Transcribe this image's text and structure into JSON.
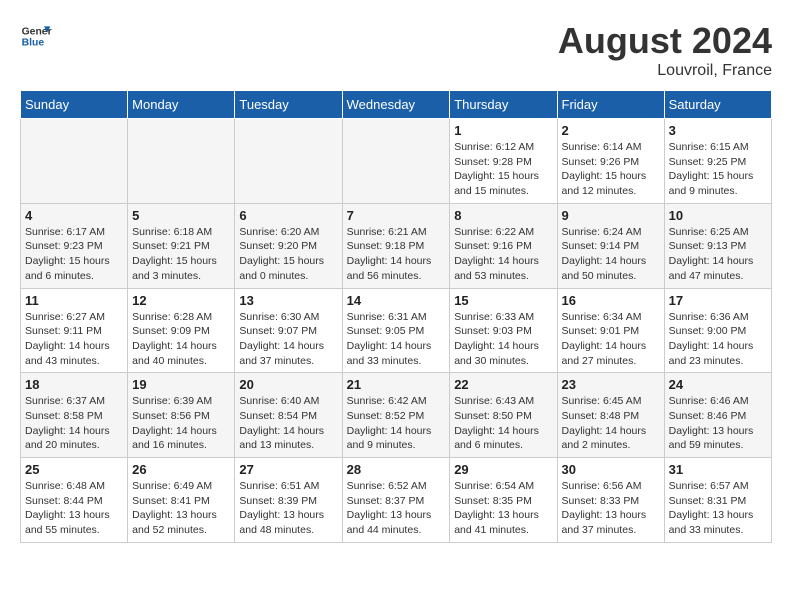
{
  "header": {
    "logo_line1": "General",
    "logo_line2": "Blue",
    "month_year": "August 2024",
    "location": "Louvroil, France"
  },
  "days_of_week": [
    "Sunday",
    "Monday",
    "Tuesday",
    "Wednesday",
    "Thursday",
    "Friday",
    "Saturday"
  ],
  "weeks": [
    [
      {
        "day": "",
        "info": ""
      },
      {
        "day": "",
        "info": ""
      },
      {
        "day": "",
        "info": ""
      },
      {
        "day": "",
        "info": ""
      },
      {
        "day": "1",
        "info": "Sunrise: 6:12 AM\nSunset: 9:28 PM\nDaylight: 15 hours and 15 minutes."
      },
      {
        "day": "2",
        "info": "Sunrise: 6:14 AM\nSunset: 9:26 PM\nDaylight: 15 hours and 12 minutes."
      },
      {
        "day": "3",
        "info": "Sunrise: 6:15 AM\nSunset: 9:25 PM\nDaylight: 15 hours and 9 minutes."
      }
    ],
    [
      {
        "day": "4",
        "info": "Sunrise: 6:17 AM\nSunset: 9:23 PM\nDaylight: 15 hours and 6 minutes."
      },
      {
        "day": "5",
        "info": "Sunrise: 6:18 AM\nSunset: 9:21 PM\nDaylight: 15 hours and 3 minutes."
      },
      {
        "day": "6",
        "info": "Sunrise: 6:20 AM\nSunset: 9:20 PM\nDaylight: 15 hours and 0 minutes."
      },
      {
        "day": "7",
        "info": "Sunrise: 6:21 AM\nSunset: 9:18 PM\nDaylight: 14 hours and 56 minutes."
      },
      {
        "day": "8",
        "info": "Sunrise: 6:22 AM\nSunset: 9:16 PM\nDaylight: 14 hours and 53 minutes."
      },
      {
        "day": "9",
        "info": "Sunrise: 6:24 AM\nSunset: 9:14 PM\nDaylight: 14 hours and 50 minutes."
      },
      {
        "day": "10",
        "info": "Sunrise: 6:25 AM\nSunset: 9:13 PM\nDaylight: 14 hours and 47 minutes."
      }
    ],
    [
      {
        "day": "11",
        "info": "Sunrise: 6:27 AM\nSunset: 9:11 PM\nDaylight: 14 hours and 43 minutes."
      },
      {
        "day": "12",
        "info": "Sunrise: 6:28 AM\nSunset: 9:09 PM\nDaylight: 14 hours and 40 minutes."
      },
      {
        "day": "13",
        "info": "Sunrise: 6:30 AM\nSunset: 9:07 PM\nDaylight: 14 hours and 37 minutes."
      },
      {
        "day": "14",
        "info": "Sunrise: 6:31 AM\nSunset: 9:05 PM\nDaylight: 14 hours and 33 minutes."
      },
      {
        "day": "15",
        "info": "Sunrise: 6:33 AM\nSunset: 9:03 PM\nDaylight: 14 hours and 30 minutes."
      },
      {
        "day": "16",
        "info": "Sunrise: 6:34 AM\nSunset: 9:01 PM\nDaylight: 14 hours and 27 minutes."
      },
      {
        "day": "17",
        "info": "Sunrise: 6:36 AM\nSunset: 9:00 PM\nDaylight: 14 hours and 23 minutes."
      }
    ],
    [
      {
        "day": "18",
        "info": "Sunrise: 6:37 AM\nSunset: 8:58 PM\nDaylight: 14 hours and 20 minutes."
      },
      {
        "day": "19",
        "info": "Sunrise: 6:39 AM\nSunset: 8:56 PM\nDaylight: 14 hours and 16 minutes."
      },
      {
        "day": "20",
        "info": "Sunrise: 6:40 AM\nSunset: 8:54 PM\nDaylight: 14 hours and 13 minutes."
      },
      {
        "day": "21",
        "info": "Sunrise: 6:42 AM\nSunset: 8:52 PM\nDaylight: 14 hours and 9 minutes."
      },
      {
        "day": "22",
        "info": "Sunrise: 6:43 AM\nSunset: 8:50 PM\nDaylight: 14 hours and 6 minutes."
      },
      {
        "day": "23",
        "info": "Sunrise: 6:45 AM\nSunset: 8:48 PM\nDaylight: 14 hours and 2 minutes."
      },
      {
        "day": "24",
        "info": "Sunrise: 6:46 AM\nSunset: 8:46 PM\nDaylight: 13 hours and 59 minutes."
      }
    ],
    [
      {
        "day": "25",
        "info": "Sunrise: 6:48 AM\nSunset: 8:44 PM\nDaylight: 13 hours and 55 minutes."
      },
      {
        "day": "26",
        "info": "Sunrise: 6:49 AM\nSunset: 8:41 PM\nDaylight: 13 hours and 52 minutes."
      },
      {
        "day": "27",
        "info": "Sunrise: 6:51 AM\nSunset: 8:39 PM\nDaylight: 13 hours and 48 minutes."
      },
      {
        "day": "28",
        "info": "Sunrise: 6:52 AM\nSunset: 8:37 PM\nDaylight: 13 hours and 44 minutes."
      },
      {
        "day": "29",
        "info": "Sunrise: 6:54 AM\nSunset: 8:35 PM\nDaylight: 13 hours and 41 minutes."
      },
      {
        "day": "30",
        "info": "Sunrise: 6:56 AM\nSunset: 8:33 PM\nDaylight: 13 hours and 37 minutes."
      },
      {
        "day": "31",
        "info": "Sunrise: 6:57 AM\nSunset: 8:31 PM\nDaylight: 13 hours and 33 minutes."
      }
    ]
  ]
}
